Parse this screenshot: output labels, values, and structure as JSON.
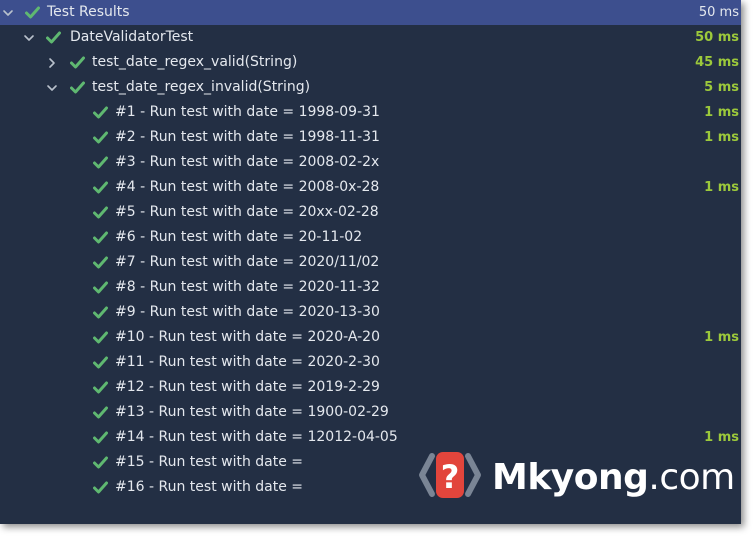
{
  "tree": {
    "rows": [
      {
        "label": "Test Results",
        "duration": "50 ms",
        "level": 0,
        "arrow": "down",
        "selected": true
      },
      {
        "label": "DateValidatorTest",
        "duration": "50 ms",
        "level": 1,
        "arrow": "down"
      },
      {
        "label": "test_date_regex_valid(String)",
        "duration": "45 ms",
        "level": 2,
        "arrow": "right"
      },
      {
        "label": "test_date_regex_invalid(String)",
        "duration": "5 ms",
        "level": 2,
        "arrow": "down"
      },
      {
        "label": "#1 - Run test with date = 1998-09-31",
        "duration": "1 ms",
        "level": 3
      },
      {
        "label": "#2 - Run test with date = 1998-11-31",
        "duration": "1 ms",
        "level": 3
      },
      {
        "label": "#3 - Run test with date = 2008-02-2x",
        "duration": "",
        "level": 3
      },
      {
        "label": "#4 - Run test with date = 2008-0x-28",
        "duration": "1 ms",
        "level": 3
      },
      {
        "label": "#5 - Run test with date = 20xx-02-28",
        "duration": "",
        "level": 3
      },
      {
        "label": "#6 - Run test with date = 20-11-02",
        "duration": "",
        "level": 3
      },
      {
        "label": "#7 - Run test with date = 2020/11/02",
        "duration": "",
        "level": 3
      },
      {
        "label": "#8 - Run test with date = 2020-11-32",
        "duration": "",
        "level": 3
      },
      {
        "label": "#9 - Run test with date = 2020-13-30",
        "duration": "",
        "level": 3
      },
      {
        "label": "#10 - Run test with date = 2020-A-20",
        "duration": "1 ms",
        "level": 3
      },
      {
        "label": "#11 - Run test with date = 2020-2-30",
        "duration": "",
        "level": 3
      },
      {
        "label": "#12 - Run test with date = 2019-2-29",
        "duration": "",
        "level": 3
      },
      {
        "label": "#13 - Run test with date = 1900-02-29",
        "duration": "",
        "level": 3
      },
      {
        "label": "#14 - Run test with date = 12012-04-05",
        "duration": "1 ms",
        "level": 3
      },
      {
        "label": "#15 - Run test with date =",
        "duration": "",
        "level": 3
      },
      {
        "label": "#16 - Run test with date =",
        "duration": "",
        "level": 3
      }
    ]
  },
  "watermark": {
    "brand": "Mkyong",
    "suffix": ".com",
    "icon": "question-mark-logo-icon"
  },
  "colors": {
    "background": "#232f44",
    "selected_row": "#3d4f8e",
    "pass_check": "#5fb871",
    "duration": "#9cc93b",
    "text": "#e4e8ee"
  }
}
